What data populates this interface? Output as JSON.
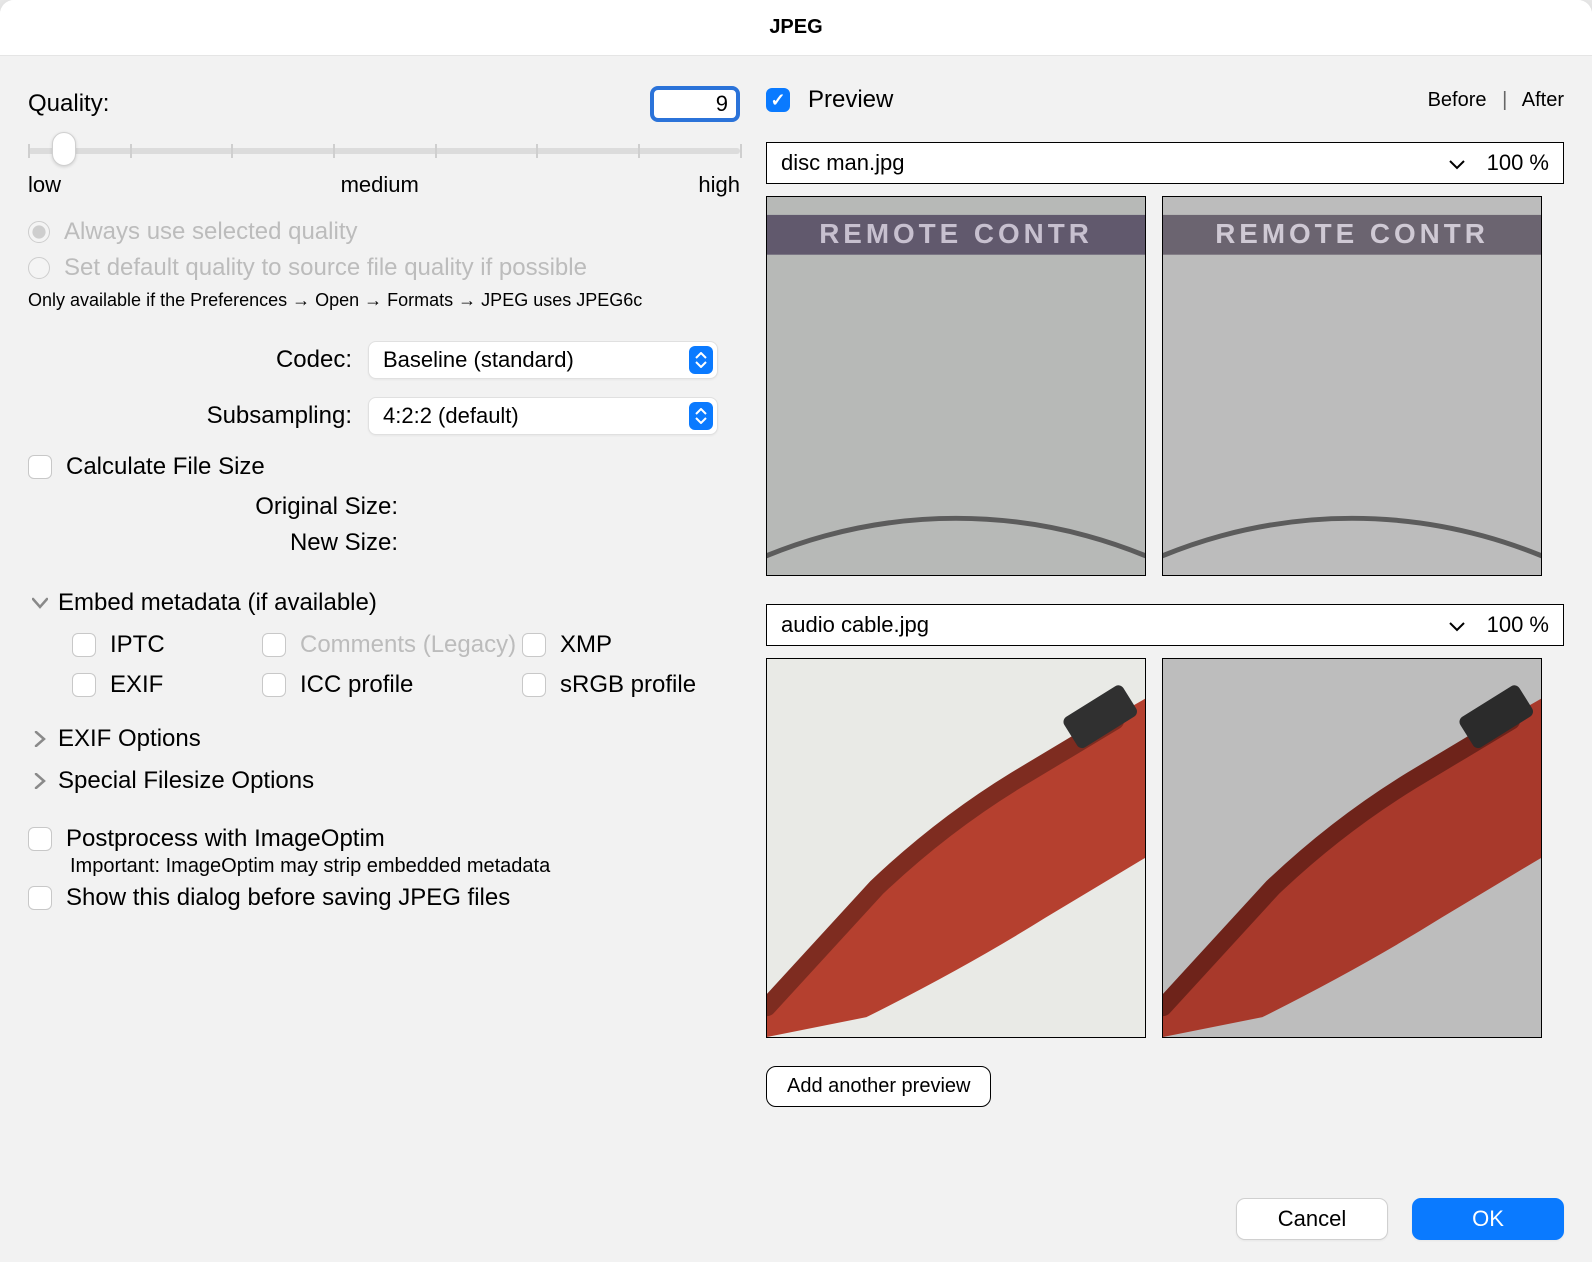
{
  "title": "JPEG",
  "quality": {
    "label": "Quality:",
    "value": "9",
    "low": "low",
    "medium": "medium",
    "high": "high",
    "thumb_pct": 5
  },
  "radios": {
    "always": "Always use selected quality",
    "default_source": "Set default quality to source file quality if possible",
    "note": "Only available if the Preferences → Open → Formats → JPEG uses JPEG6c"
  },
  "codec": {
    "label": "Codec:",
    "value": "Baseline (standard)"
  },
  "subsampling": {
    "label": "Subsampling:",
    "value": "4:2:2 (default)"
  },
  "calc_size": "Calculate File Size",
  "original_size": {
    "label": "Original Size:",
    "value": ""
  },
  "new_size": {
    "label": "New Size:",
    "value": ""
  },
  "embed": {
    "title": "Embed metadata (if available)",
    "iptc": "IPTC",
    "comments": "Comments (Legacy)",
    "xmp": "XMP",
    "exif": "EXIF",
    "icc": "ICC profile",
    "srgb": "sRGB profile"
  },
  "exif_options": "EXIF Options",
  "filesize_options": "Special Filesize Options",
  "postprocess": "Postprocess with ImageOptim",
  "postprocess_note": "Important: ImageOptim may strip embedded metadata",
  "show_dialog": "Show this dialog before saving JPEG files",
  "preview": {
    "label": "Preview",
    "before": "Before",
    "after": "After",
    "files": [
      {
        "name": "disc man.jpg",
        "zoom": "100 %"
      },
      {
        "name": "audio cable.jpg",
        "zoom": "100 %"
      }
    ],
    "add_another": "Add another preview"
  },
  "buttons": {
    "cancel": "Cancel",
    "ok": "OK"
  }
}
